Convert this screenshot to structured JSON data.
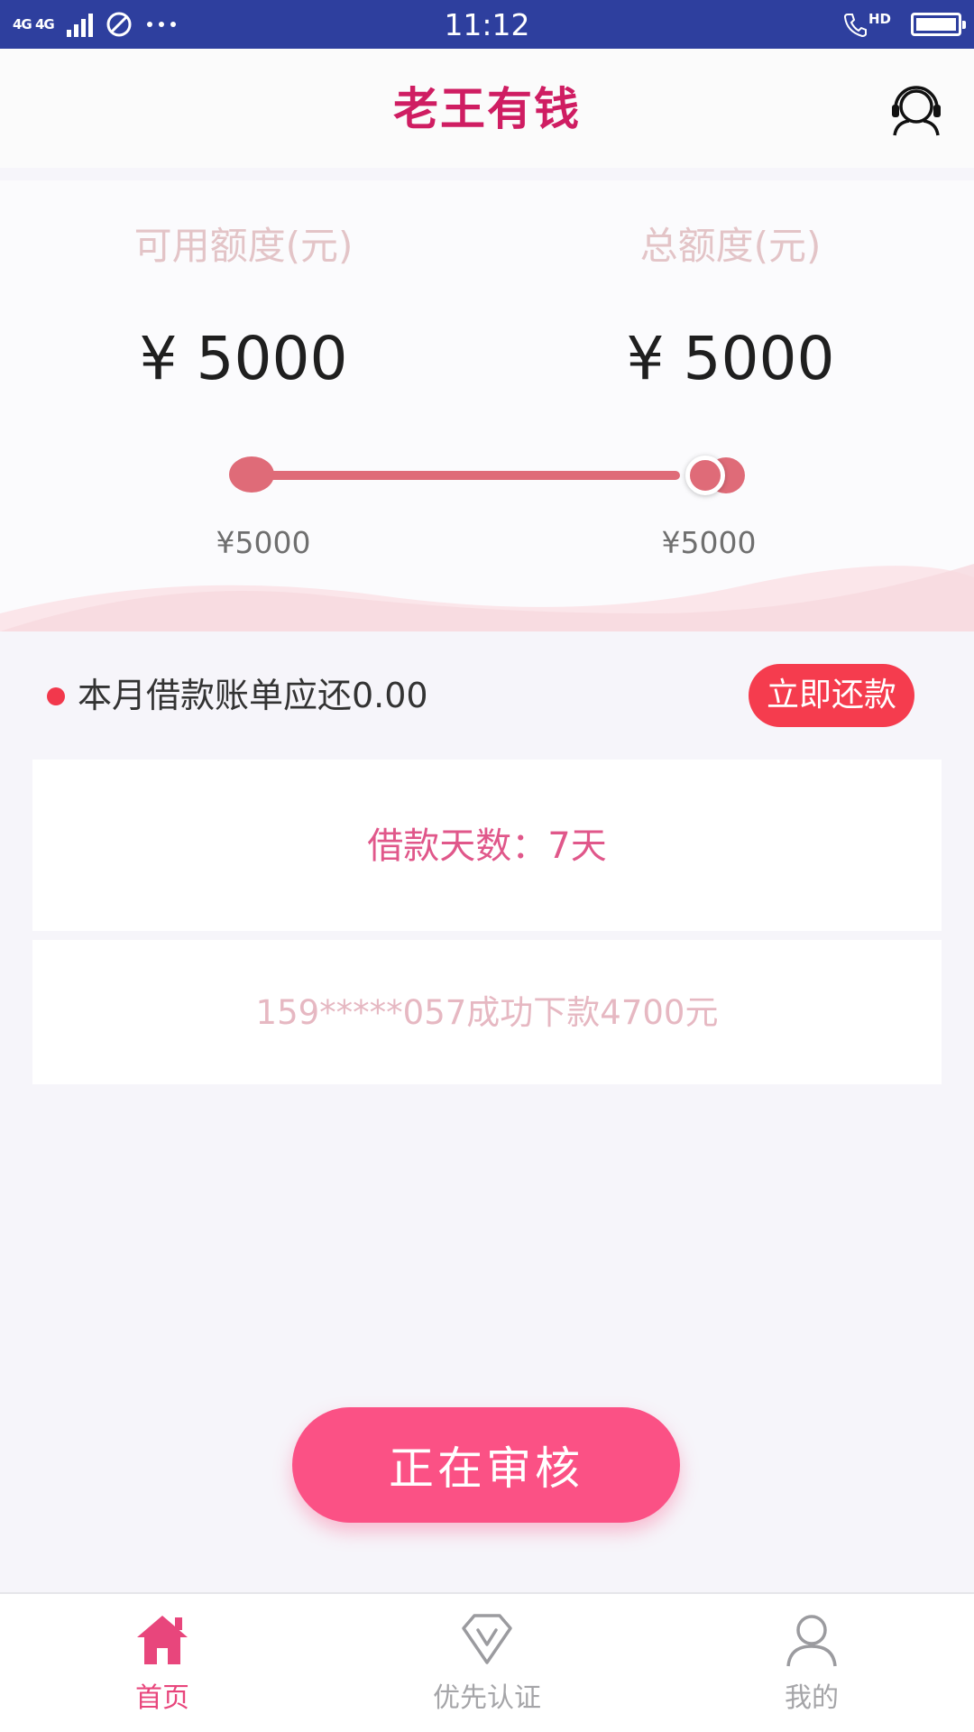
{
  "status_bar": {
    "network": "4G 4G",
    "time": "11:12",
    "call_badge": "HD",
    "icons": [
      "signal-icon",
      "no-disturb-icon",
      "more-dots-icon",
      "hd-call-icon",
      "battery-icon"
    ]
  },
  "header": {
    "title": "老王有钱",
    "icon": "customer-service-icon"
  },
  "quota": {
    "available_label": "可用额度(元)",
    "available_value": "¥ 5000",
    "total_label": "总额度(元)",
    "total_value": "¥ 5000",
    "slider": {
      "min_label": "¥5000",
      "max_label": "¥5000",
      "level": 1.0
    }
  },
  "bill": {
    "text": "本月借款账单应还0.00",
    "repay_button": "立即还款"
  },
  "loan_days": {
    "text": "借款天数：7天"
  },
  "ticker": {
    "text": "159*****057成功下款4700元"
  },
  "action": {
    "review_button": "正在审核"
  },
  "tabs": [
    {
      "label": "首页",
      "icon": "home-icon",
      "active": true
    },
    {
      "label": "优先认证",
      "icon": "verify-v-icon",
      "active": false
    },
    {
      "label": "我的",
      "icon": "user-icon",
      "active": false
    }
  ],
  "colors": {
    "status_bar": "#2e3f9e",
    "brand": "#cf1d62",
    "slider": "#df6b78",
    "primary_button": "#fb5185",
    "repay_button": "#f53c4e",
    "tab_active": "#e8467c"
  }
}
